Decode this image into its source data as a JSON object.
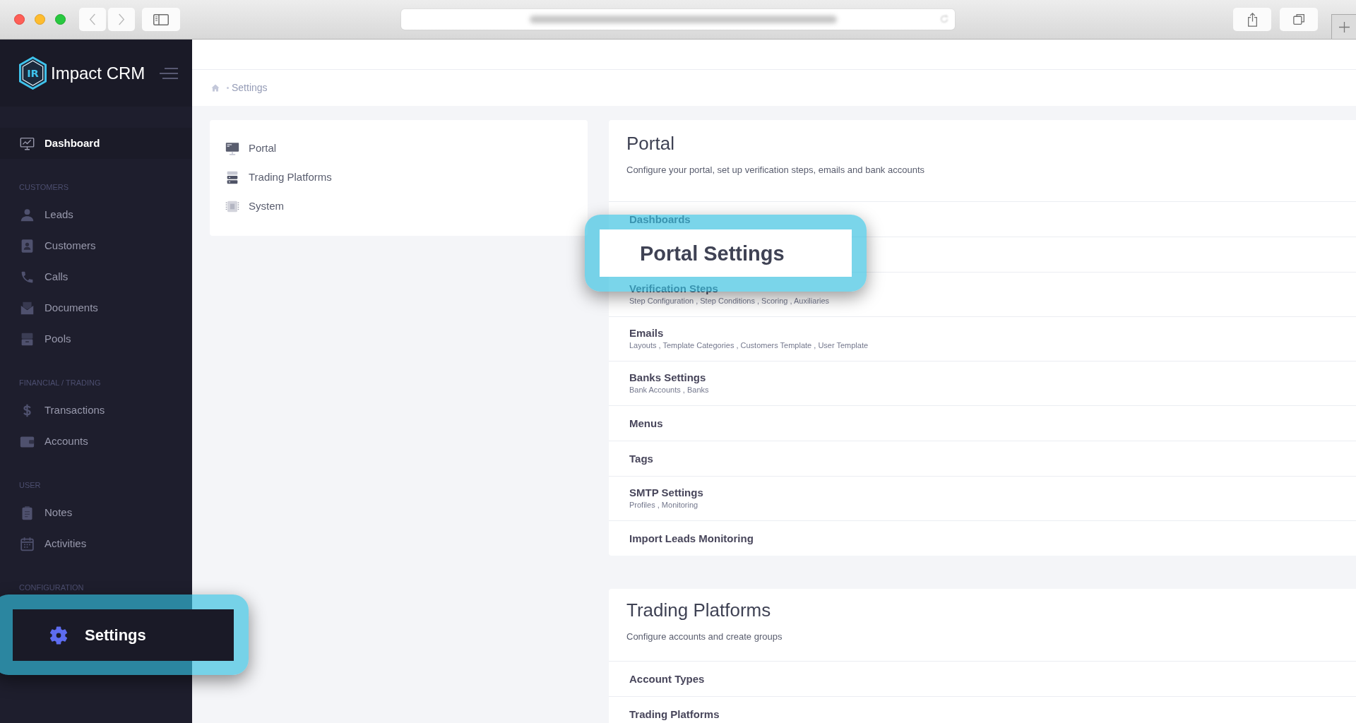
{
  "brand": {
    "mark": "IR",
    "name": "Impact CRM"
  },
  "sidebar": {
    "items": [
      {
        "label": "Dashboard",
        "selected": true,
        "highlighted": false
      }
    ],
    "sections": [
      {
        "heading": "CUSTOMERS",
        "items": [
          {
            "label": "Leads",
            "selected": false,
            "highlighted": false
          },
          {
            "label": "Customers",
            "selected": false,
            "highlighted": false
          },
          {
            "label": "Calls",
            "selected": false,
            "highlighted": false
          },
          {
            "label": "Documents",
            "selected": false,
            "highlighted": false
          },
          {
            "label": "Pools",
            "selected": false,
            "highlighted": false
          }
        ]
      },
      {
        "heading": "FINANCIAL / TRADING",
        "items": [
          {
            "label": "Transactions",
            "selected": false,
            "highlighted": false
          },
          {
            "label": "Accounts",
            "selected": false,
            "highlighted": false
          }
        ]
      },
      {
        "heading": "USER",
        "items": [
          {
            "label": "Notes",
            "selected": false,
            "highlighted": false
          },
          {
            "label": "Activities",
            "selected": false,
            "highlighted": false
          }
        ]
      },
      {
        "heading": "CONFIGURATION",
        "items": [
          {
            "label": "Settings",
            "selected": true,
            "highlighted": true
          }
        ]
      }
    ]
  },
  "breadcrumb": [
    {
      "label": "Settings"
    }
  ],
  "settings_menu": [
    {
      "label": "Portal"
    },
    {
      "label": "Trading Platforms"
    },
    {
      "label": "System"
    }
  ],
  "panels": [
    {
      "title": "Portal",
      "description": "Configure your portal, set up verification steps, emails and bank accounts",
      "rows": [
        {
          "title": "Dashboards",
          "highlighted": false
        },
        {
          "title": "Portal Settings",
          "highlighted": true
        },
        {
          "title": "Verification Steps",
          "subtitle": "Step Configuration , Step Conditions , Scoring , Auxiliaries",
          "highlighted": false
        },
        {
          "title": "Emails",
          "subtitle": "Layouts , Template Categories , Customers Template , User Template",
          "highlighted": false
        },
        {
          "title": "Banks Settings",
          "subtitle": "Bank Accounts , Banks",
          "highlighted": false
        },
        {
          "title": "Menus",
          "highlighted": false
        },
        {
          "title": "Tags",
          "highlighted": false
        },
        {
          "title": "SMTP Settings",
          "subtitle": "Profiles , Monitoring",
          "highlighted": false
        },
        {
          "title": "Import Leads Monitoring",
          "highlighted": false
        }
      ]
    },
    {
      "title": "Trading Platforms",
      "description": "Configure accounts and create groups",
      "rows": [
        {
          "title": "Account Types",
          "highlighted": false
        },
        {
          "title": "Trading Platforms",
          "highlighted": false
        }
      ]
    }
  ]
}
